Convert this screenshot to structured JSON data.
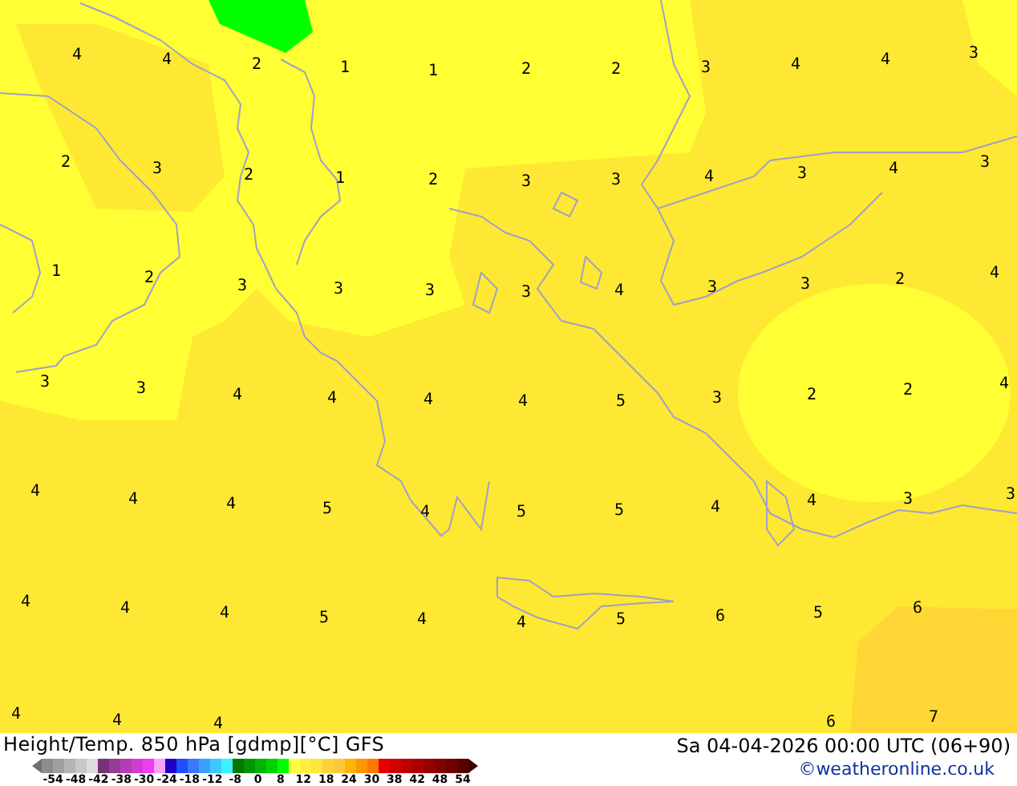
{
  "map": {
    "value_rows": [
      [
        "4",
        "4",
        "2",
        "1",
        "1",
        "2",
        "2",
        "3",
        "4",
        "4",
        "3"
      ],
      [
        "2",
        "3",
        "2",
        "1",
        "2",
        "3",
        "3",
        "4",
        "3",
        "4",
        "3"
      ],
      [
        "1",
        "2",
        "3",
        "3",
        "3",
        "3",
        "4",
        "3",
        "3",
        "2",
        "4"
      ],
      [
        "3",
        "3",
        "4",
        "4",
        "4",
        "4",
        "5",
        "3",
        "2",
        "2",
        "4"
      ],
      [
        "4",
        "4",
        "4",
        "5",
        "4",
        "5",
        "5",
        "4",
        "4",
        "3",
        "3"
      ],
      [
        "4",
        "4",
        "4",
        "5",
        "4",
        "4",
        "5",
        "6",
        "5",
        "6"
      ],
      [
        "4",
        "4",
        "4",
        "6",
        "7"
      ]
    ]
  },
  "footer": {
    "title": "Height/Temp. 850 hPa [gdmp][°C] GFS",
    "datetime": "Sa 04-04-2026 00:00 UTC (06+90)",
    "credit": "©weatheronline.co.uk"
  },
  "legend": {
    "swatches": [
      {
        "color": "#8c8c8c"
      },
      {
        "color": "#a0a0a0"
      },
      {
        "color": "#b4b4b4"
      },
      {
        "color": "#c8c8c8"
      },
      {
        "color": "#dcdcdc"
      },
      {
        "color": "#783278"
      },
      {
        "color": "#963c96"
      },
      {
        "color": "#b43cb4"
      },
      {
        "color": "#d23cd2"
      },
      {
        "color": "#f03cf0"
      },
      {
        "color": "#ffa0ff"
      },
      {
        "color": "#1e00c8"
      },
      {
        "color": "#1e50ff"
      },
      {
        "color": "#3c78ff"
      },
      {
        "color": "#3ca0ff"
      },
      {
        "color": "#3cc8ff"
      },
      {
        "color": "#3cf0ff"
      },
      {
        "color": "#007800"
      },
      {
        "color": "#009600"
      },
      {
        "color": "#00b400"
      },
      {
        "color": "#00d200"
      },
      {
        "color": "#00ff00"
      },
      {
        "color": "#ffff3c"
      },
      {
        "color": "#fff03c"
      },
      {
        "color": "#ffe63c"
      },
      {
        "color": "#ffd23c"
      },
      {
        "color": "#ffc83c"
      },
      {
        "color": "#ffb400"
      },
      {
        "color": "#ff9600"
      },
      {
        "color": "#ff7800"
      },
      {
        "color": "#e60000"
      },
      {
        "color": "#d20000"
      },
      {
        "color": "#be0000"
      },
      {
        "color": "#aa0000"
      },
      {
        "color": "#960000"
      },
      {
        "color": "#820000"
      },
      {
        "color": "#6e0000"
      },
      {
        "color": "#5a0000"
      }
    ],
    "ticks": [
      "-54",
      "-48",
      "-42",
      "-38",
      "-30",
      "-24",
      "-18",
      "-12",
      "-8",
      "0",
      "8",
      "12",
      "18",
      "24",
      "30",
      "38",
      "42",
      "48",
      "54"
    ]
  }
}
